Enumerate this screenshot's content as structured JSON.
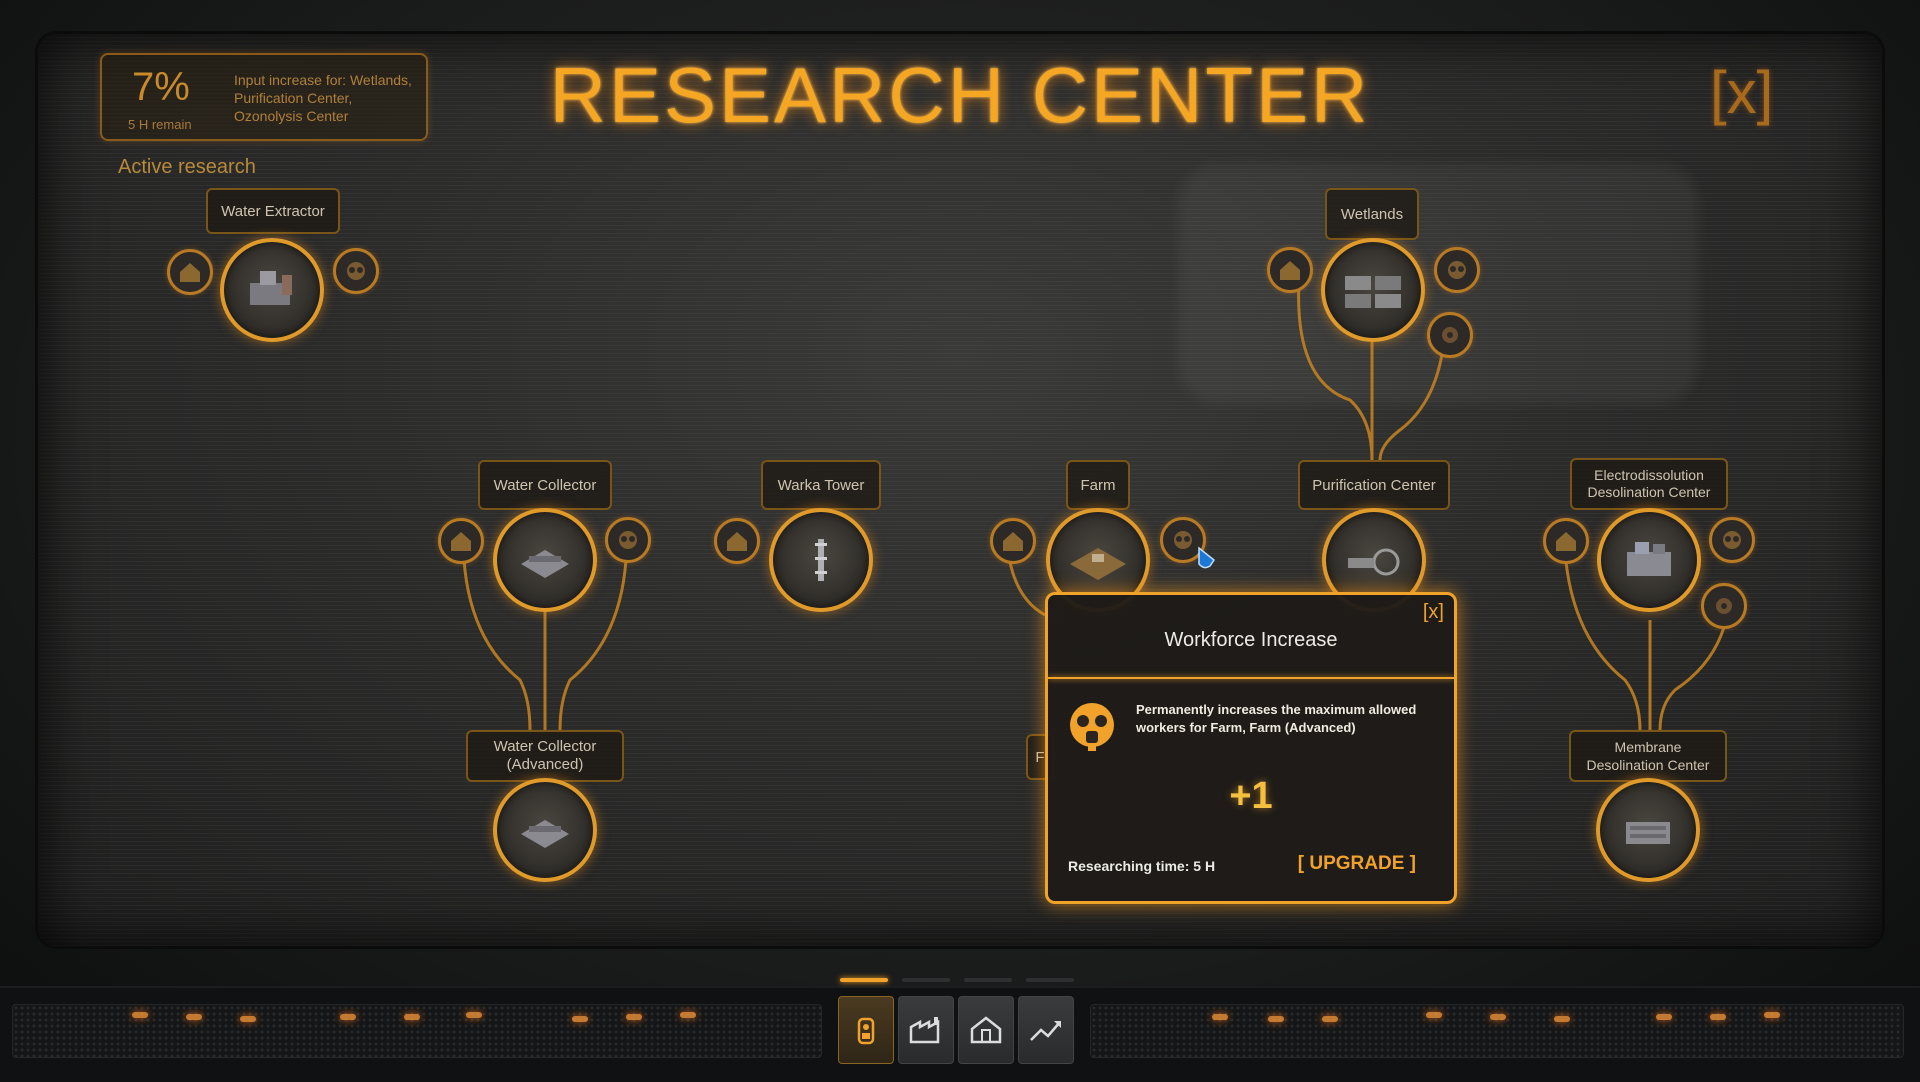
{
  "header": {
    "title": "RESEARCH CENTER",
    "close_label": "[x]"
  },
  "active_research": {
    "percent": "7%",
    "remaining": "5 H remain",
    "description": "Input increase for: Wetlands, Purification Center, Ozonolysis Center",
    "section_label": "Active research"
  },
  "nodes": {
    "water_extractor": "Water Extractor",
    "wetlands": "Wetlands",
    "water_collector": "Water Collector",
    "warka_tower": "Warka Tower",
    "farm": "Farm",
    "purification_center": "Purification Center",
    "electrodissolution": "Electrodissolution Desolination Center",
    "water_collector_advanced": "Water Collector (Advanced)",
    "membrane": "Membrane Desolination Center",
    "hidden_partial": "F"
  },
  "popup": {
    "close_label": "[x]",
    "title": "Workforce Increase",
    "description": "Permanently increases the maximum allowed workers for Farm, Farm (Advanced)",
    "value": "+1",
    "research_time": "Researching time: 5 H",
    "upgrade_label": "[ UPGRADE ]",
    "icon": "gas-mask-icon"
  },
  "bottom_tabs": [
    {
      "icon": "research-tower-icon",
      "active": true
    },
    {
      "icon": "factory-icon",
      "active": false
    },
    {
      "icon": "house-icon",
      "active": false
    },
    {
      "icon": "trend-chart-icon",
      "active": false
    }
  ],
  "colors": {
    "accent": "#f0a22a",
    "title": "#f5a623",
    "background": "#2c2c2b"
  }
}
